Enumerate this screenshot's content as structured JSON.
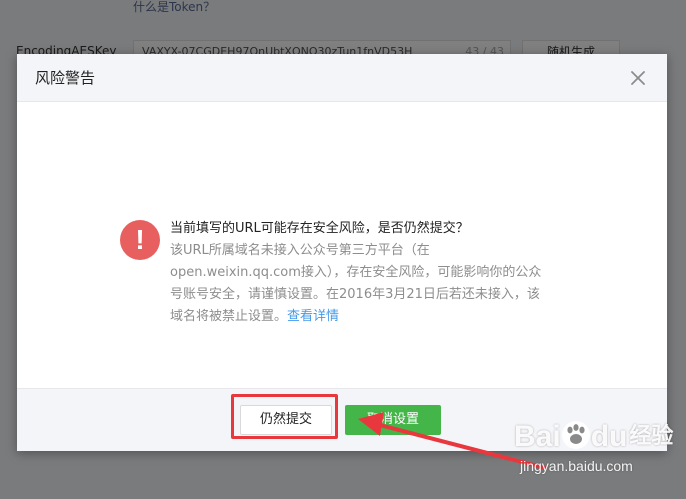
{
  "background": {
    "token_link": "什么是Token？",
    "aes_label": "EncodingAESKey",
    "aes_value": "VAXYX-07CGDEH97QnUbtXQNO30zTun1fnVD53H",
    "aes_counter": "43 / 43",
    "generate_button": "随机生成"
  },
  "dialog": {
    "title": "风险警告",
    "message_title": "当前填写的URL可能存在安全风险，是否仍然提交？",
    "message_desc": "该URL所属域名未接入公众号第三方平台（在open.weixin.qq.com接入），存在安全风险，可能影响你的公众号账号安全，请谨慎设置。在2016年3月21日后若还未接入，该域名将被禁止设置。",
    "details_link": "查看详情",
    "submit_button": "仍然提交",
    "cancel_button": "取消设置"
  },
  "watermark": {
    "logo_text": "Bai",
    "logo_text_2": "du",
    "logo_cn": "经验",
    "url": "jingyan.baidu.com"
  },
  "colors": {
    "accent_green": "#44b549",
    "warning_red": "#e85f5f",
    "annotation_red": "#e8383d",
    "link_blue": "#459ae9"
  }
}
